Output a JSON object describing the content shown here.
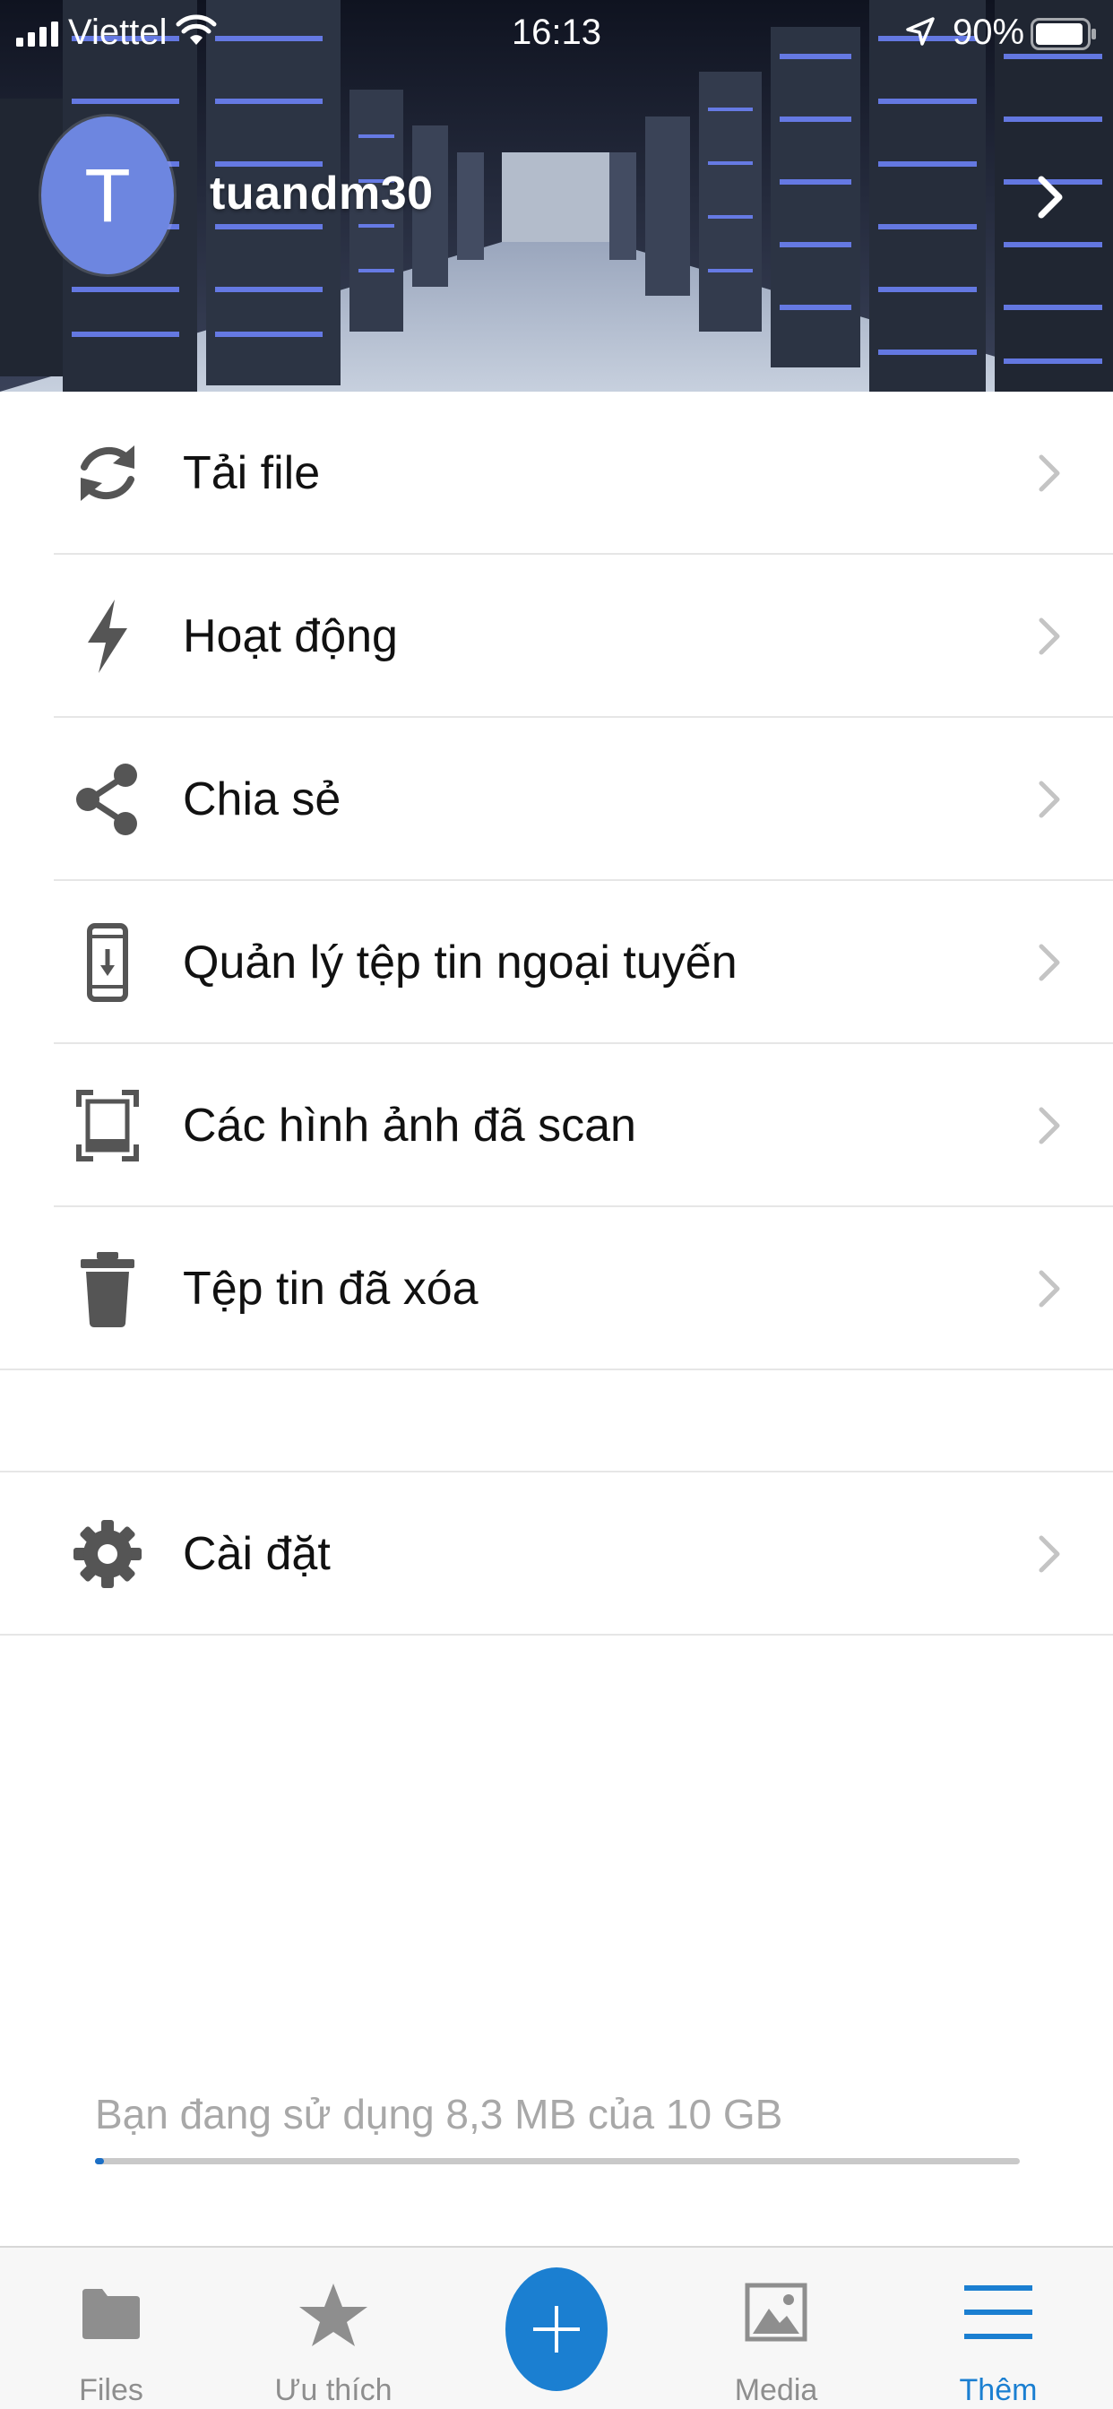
{
  "status_bar": {
    "carrier": "Viettel",
    "time": "16:13",
    "battery": "90%"
  },
  "profile": {
    "initial": "T",
    "username": "tuandm30",
    "avatar_color": "#6d86e0"
  },
  "menu": {
    "items": [
      {
        "label": "Tải file",
        "icon": "sync-icon"
      },
      {
        "label": "Hoạt động",
        "icon": "lightning-icon"
      },
      {
        "label": "Chia sẻ",
        "icon": "share-icon"
      },
      {
        "label": "Quản lý tệp tin ngoại tuyến",
        "icon": "offline-phone-icon"
      },
      {
        "label": "Các hình ảnh đã scan",
        "icon": "scan-icon"
      },
      {
        "label": "Tệp tin đã xóa",
        "icon": "trash-icon"
      }
    ],
    "settings": {
      "label": "Cài đặt",
      "icon": "gear-icon"
    }
  },
  "storage": {
    "text": "Bạn đang sử dụng 8,3 MB của 10 GB",
    "used_fraction": 0.01
  },
  "tabbar": {
    "tabs": [
      {
        "label": "Files",
        "icon": "folder-icon",
        "active": false
      },
      {
        "label": "Ưu thích",
        "icon": "star-icon",
        "active": false
      },
      {
        "label": "",
        "icon": "plus-icon",
        "active": false
      },
      {
        "label": "Media",
        "icon": "image-icon",
        "active": false
      },
      {
        "label": "Thêm",
        "icon": "menu-icon",
        "active": true
      }
    ],
    "accent_color": "#1b7fd1"
  }
}
